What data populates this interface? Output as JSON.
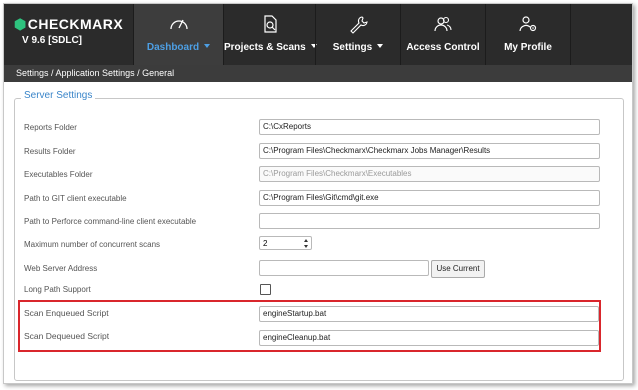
{
  "brand": {
    "name": "CHECKMARX",
    "version": "V 9.6  [SDLC]"
  },
  "nav": [
    {
      "label": "Dashboard",
      "icon": "gauge-icon",
      "active": true,
      "dropdown": true
    },
    {
      "label": "Projects & Scans",
      "icon": "document-search-icon",
      "active": false,
      "dropdown": true
    },
    {
      "label": "Settings",
      "icon": "wrench-icon",
      "active": false,
      "dropdown": true
    },
    {
      "label": "Access Control",
      "icon": "users-icon",
      "active": false,
      "dropdown": false
    },
    {
      "label": "My Profile",
      "icon": "user-gear-icon",
      "active": false,
      "dropdown": false
    }
  ],
  "breadcrumb": "Settings / Application Settings / General",
  "section_title": "Server Settings",
  "fields": {
    "reports_folder": {
      "label": "Reports Folder",
      "value": "C:\\CxReports"
    },
    "results_folder": {
      "label": "Results Folder",
      "value": "C:\\Program Files\\Checkmarx\\Checkmarx Jobs Manager\\Results"
    },
    "executables_folder": {
      "label": "Executables Folder",
      "value": "C:\\Program Files\\Checkmarx\\Executables"
    },
    "git_path": {
      "label": "Path to GIT client executable",
      "value": "C:\\Program Files\\Git\\cmd\\git.exe"
    },
    "perforce_path": {
      "label": "Path to Perforce command-line client executable",
      "value": ""
    },
    "max_scans": {
      "label": "Maximum number of concurrent scans",
      "value": "2"
    },
    "web_server": {
      "label": "Web Server Address",
      "value": "",
      "button_label": "Use Current"
    },
    "long_path": {
      "label": "Long Path Support",
      "checked": false
    },
    "scan_enqueued": {
      "label": "Scan Enqueued Script",
      "value": "engineStartup.bat"
    },
    "scan_dequeued": {
      "label": "Scan Dequeued Script",
      "value": "engineCleanup.bat"
    }
  },
  "colors": {
    "topbar": "#2b2b2b",
    "active_nav_text": "#4d9fe4",
    "legend": "#3a85c9",
    "highlight": "#d9262c",
    "brand_mark": "#2ec27e"
  }
}
